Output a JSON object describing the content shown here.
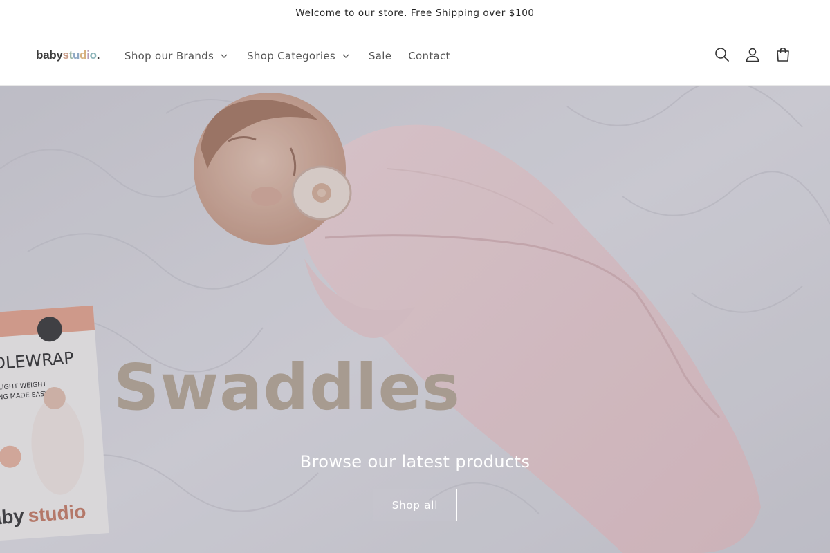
{
  "announcement": {
    "text": "Welcome to our store. Free Shipping over $100"
  },
  "logo": {
    "baby": "baby",
    "letters": [
      "s",
      "t",
      "u",
      "d",
      "i",
      "o"
    ],
    "dot": "."
  },
  "nav": {
    "shop_brands": "Shop our Brands",
    "shop_categories": "Shop Categories",
    "sale": "Sale",
    "contact": "Contact"
  },
  "icons": {
    "search": "search-icon",
    "account": "account-icon",
    "cart": "cart-icon"
  },
  "hero": {
    "headline": "Swaddles",
    "subheading": "Browse our latest products",
    "button_label": "Shop all",
    "package": {
      "brand_text": "babystudio",
      "title_text": "DDLEWRAP",
      "line1": "AND LIGHT WEIGHT",
      "line2": "DDLING MADE EASY"
    }
  },
  "colors": {
    "headline": "#a79b90",
    "swaddle": "#efd6d8",
    "blanket": "#dddde3"
  }
}
